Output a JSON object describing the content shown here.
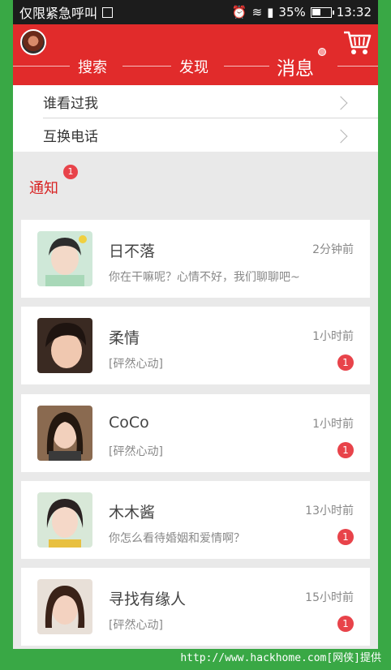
{
  "status_bar": {
    "carrier": "仅限紧急呼叫",
    "battery": "35%",
    "time": "13:32"
  },
  "header": {
    "tabs": [
      {
        "label": "搜索",
        "active": false
      },
      {
        "label": "发现",
        "active": false
      },
      {
        "label": "消息",
        "active": true
      }
    ],
    "accent_color": "#e12b2b"
  },
  "menu": {
    "items": [
      {
        "label": "谁看过我"
      },
      {
        "label": "互换电话"
      }
    ]
  },
  "notice": {
    "title": "通知",
    "badge": "1"
  },
  "messages": [
    {
      "name": "日不落",
      "time": "2分钟前",
      "text": "你在干嘛呢？心情不好，我们聊聊吧~",
      "badge": null
    },
    {
      "name": "柔情",
      "time": "1小时前",
      "text": "[砰然心动]",
      "badge": "1"
    },
    {
      "name": "CoCo",
      "time": "1小时前",
      "text": "[砰然心动]",
      "badge": "1"
    },
    {
      "name": "木木酱",
      "time": "13小时前",
      "text": "你怎么看待婚姻和爱情啊？",
      "badge": "1"
    },
    {
      "name": "寻找有缘人",
      "time": "15小时前",
      "text": "[砰然心动]",
      "badge": "1"
    }
  ],
  "watermark": "http://www.hackhome.com[网侠]提供"
}
